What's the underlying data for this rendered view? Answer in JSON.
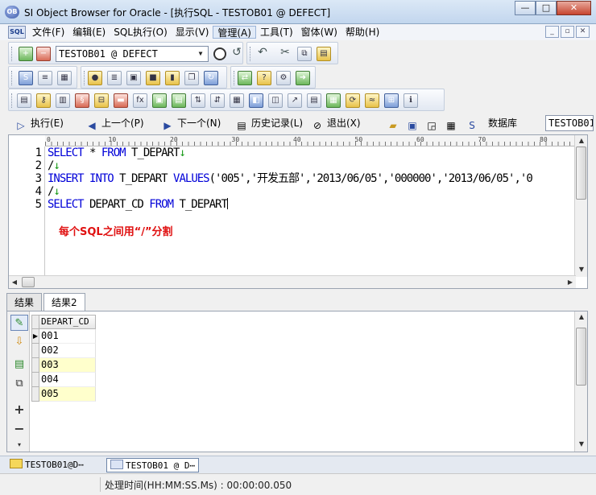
{
  "window": {
    "title": "SI Object Browser for Oracle - [执行SQL  - TESTOB01 @ DEFECT]",
    "app_icon_label": "OB",
    "minimize": "—",
    "maximize": "□",
    "close": "✕"
  },
  "menu": {
    "items": [
      "文件(F)",
      "编辑(E)",
      "SQL执行(O)",
      "显示(V)",
      "管理(A)",
      "工具(T)",
      "窗体(W)",
      "帮助(H)"
    ],
    "active_index": 4,
    "sql_icon": "SQL",
    "mdi": [
      "_",
      "▫",
      "✕"
    ]
  },
  "toolbar": {
    "connection": "TESTOB01 @ DEFECT"
  },
  "actions": {
    "execute": "执行(E)",
    "prev": "上一个(P)",
    "next": "下一个(N)",
    "history": "历史记录(L)",
    "exit": "退出(X)",
    "database_label": "数据库",
    "database_value": "TESTOB01"
  },
  "editor": {
    "ruler_marks": [
      "0",
      "10",
      "20",
      "30",
      "40",
      "50",
      "60",
      "70",
      "80"
    ],
    "line_numbers": [
      "1",
      "2",
      "3",
      "4",
      "5"
    ],
    "lines": [
      [
        {
          "t": "kw",
          "v": "SELECT"
        },
        {
          "t": "str",
          "v": " * "
        },
        {
          "t": "kw",
          "v": "FROM"
        },
        {
          "t": "str",
          "v": " T_DEPART"
        },
        {
          "t": "eol",
          "v": "↓"
        }
      ],
      [
        {
          "t": "str",
          "v": "/"
        },
        {
          "t": "eol",
          "v": "↓"
        }
      ],
      [
        {
          "t": "kw",
          "v": "INSERT"
        },
        {
          "t": "str",
          "v": " "
        },
        {
          "t": "kw",
          "v": "INTO"
        },
        {
          "t": "str",
          "v": " T_DEPART "
        },
        {
          "t": "kw",
          "v": "VALUES"
        },
        {
          "t": "str",
          "v": "('005','开发五部','2013/06/05','000000','2013/06/05','0"
        }
      ],
      [
        {
          "t": "str",
          "v": "/"
        },
        {
          "t": "eol",
          "v": "↓"
        }
      ],
      [
        {
          "t": "kw",
          "v": "SELECT"
        },
        {
          "t": "str",
          "v": " DEPART_CD "
        },
        {
          "t": "kw",
          "v": "FROM"
        },
        {
          "t": "str",
          "v": " T_DEPART"
        }
      ]
    ],
    "annotation": "每个SQL之间用“/”分割"
  },
  "tabs": [
    {
      "label": "结果",
      "active": false
    },
    {
      "label": "结果2",
      "active": true
    }
  ],
  "grid": {
    "column": "DEPART_CD",
    "rows": [
      "001",
      "002",
      "003",
      "004",
      "005"
    ],
    "current_row": 0
  },
  "tasks": [
    {
      "label": "TESTOB01@D⋯",
      "active": false
    },
    {
      "label": "TESTOB01 @ D⋯",
      "active": true
    }
  ],
  "status": {
    "elapsed": "处理时间(HH:MM:SS.Ms) : 00:00:00.050"
  }
}
